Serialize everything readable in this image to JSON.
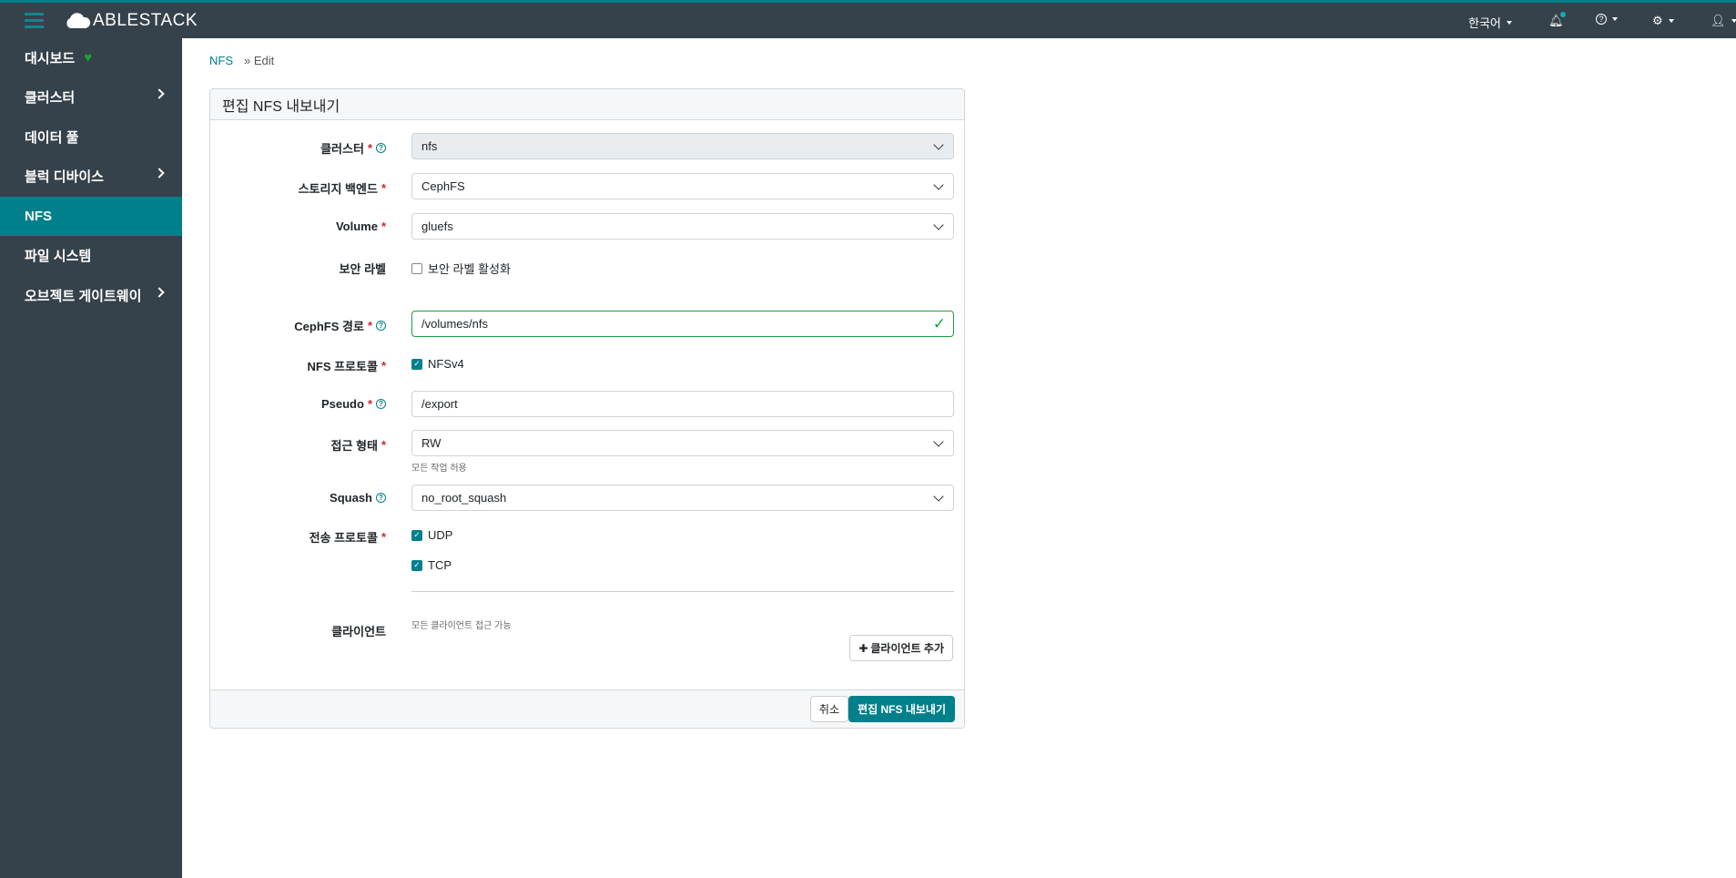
{
  "header": {
    "brand": "ABLESTACK",
    "language": "한국어"
  },
  "sidebar": {
    "items": [
      {
        "label": "대시보드"
      },
      {
        "label": "클러스터"
      },
      {
        "label": "데이터 풀"
      },
      {
        "label": "블럭 디바이스"
      },
      {
        "label": "NFS"
      },
      {
        "label": "파일 시스템"
      },
      {
        "label": "오브젝트 게이트웨이"
      }
    ]
  },
  "breadcrumb": {
    "parent": "NFS",
    "current": "Edit"
  },
  "form": {
    "title": "편집 NFS 내보내기",
    "cluster": {
      "label": "클러스터",
      "value": "nfs"
    },
    "backend": {
      "label": "스토리지 백엔드",
      "value": "CephFS"
    },
    "volume": {
      "label": "Volume",
      "value": "gluefs"
    },
    "security": {
      "label": "보안 라벨",
      "checkbox": "보안 라벨 활성화"
    },
    "path": {
      "label": "CephFS 경로",
      "value": "/volumes/nfs"
    },
    "protocol": {
      "label": "NFS 프로토콜",
      "option": "NFSv4"
    },
    "pseudo": {
      "label": "Pseudo",
      "value": "/export"
    },
    "access": {
      "label": "접근 형태",
      "value": "RW",
      "hint": "모든 작업 허용"
    },
    "squash": {
      "label": "Squash",
      "value": "no_root_squash"
    },
    "transport": {
      "label": "전송 프로토콜",
      "options": [
        "UDP",
        "TCP"
      ]
    },
    "clients": {
      "label": "클라이언트",
      "hint": "모든 클라이언트 접근 가능",
      "add": "클라이언트 추가"
    },
    "required": "*",
    "cancel": "취소",
    "submit": "편집 NFS 내보내기"
  }
}
